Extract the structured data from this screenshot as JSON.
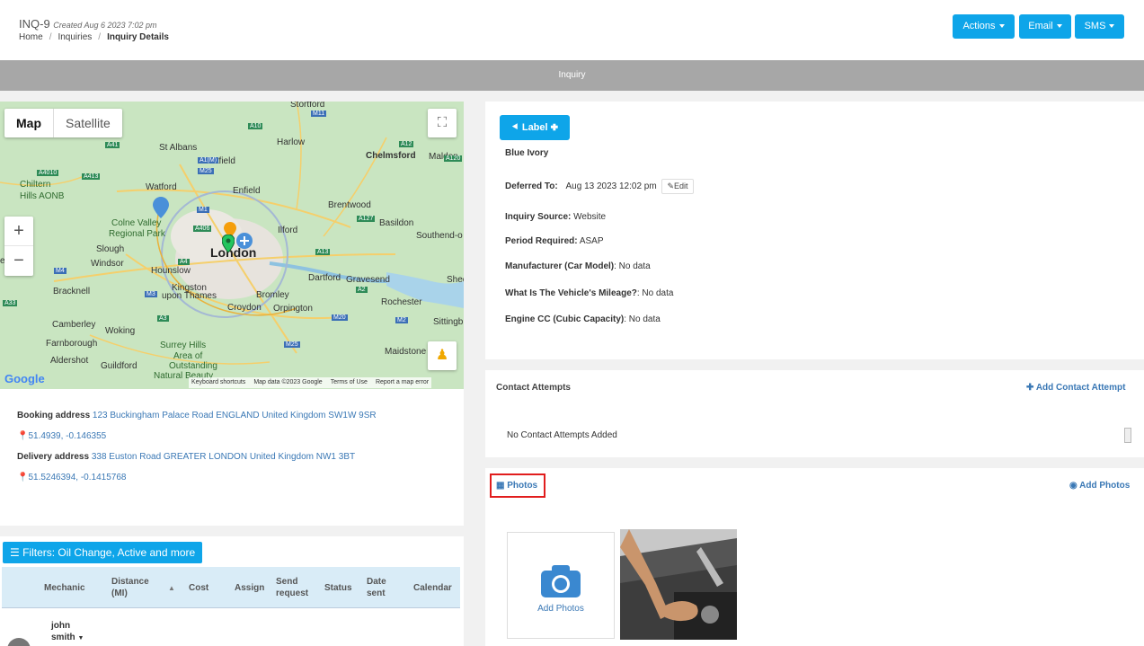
{
  "header": {
    "inquiry_id": "INQ-9",
    "created": "Created Aug 6 2023 7:02 pm",
    "breadcrumb": [
      "Home",
      "Inquiries",
      "Inquiry Details"
    ],
    "buttons": {
      "actions": "Actions",
      "email": "Email",
      "sms": "SMS"
    }
  },
  "section_bar": "Inquiry",
  "map": {
    "type_map": "Map",
    "type_satellite": "Satellite",
    "zoom_in": "+",
    "zoom_out": "−",
    "labels": {
      "stortford": "Stortford",
      "m11": "M11",
      "a10": "A10",
      "harlow": "Harlow",
      "st_albans": "St Albans",
      "hatfield": "Hatfield",
      "chelmsford": "Chelmsford",
      "maldon": "Maldon",
      "a41": "A41",
      "a1m": "A1(M)",
      "m25": "M25",
      "a12": "A12",
      "a120": "A120",
      "a4010": "A4010",
      "a413": "A413",
      "watford": "Watford",
      "enfield": "Enfield",
      "chiltern": "Chiltern",
      "hills_aonb": "Hills AONB",
      "brentwood": "Brentwood",
      "colne_valley": "Colne Valley",
      "regional_park": "Regional Park",
      "m1": "M1",
      "a406": "A406",
      "a127": "A127",
      "basildon": "Basildon",
      "ilford": "Ilford",
      "southend": "Southend-o",
      "slough": "Slough",
      "windsor": "Windsor",
      "hounslow": "Hounslow",
      "london": "London",
      "a13": "A13",
      "m4": "M4",
      "a4": "A4",
      "reading": "eading",
      "bracknell": "Bracknell",
      "m3": "M3",
      "kingston": "Kingston",
      "upon_thames": "upon Thames",
      "bromley": "Bromley",
      "dartford": "Dartford",
      "gravesend": "Gravesend",
      "a2": "A2",
      "a33": "A33",
      "croydon": "Croydon",
      "orpington": "Orpington",
      "rochester": "Rochester",
      "m20": "M20",
      "m2": "M2",
      "camberley": "Camberley",
      "woking": "Woking",
      "a3": "A3",
      "sittingb": "Sittingb",
      "farnborough": "Farnborough",
      "surrey_hills": "Surrey Hills",
      "area_of": "Area of",
      "outstanding": "Outstanding",
      "natural_beauty": "Natural Beauty",
      "aldershot": "Aldershot",
      "guildford": "Guildford",
      "maidstone": "Maidstone",
      "shee": "Shee"
    },
    "footer": [
      "Keyboard shortcuts",
      "Map data ©2023 Google",
      "Terms of Use",
      "Report a map error"
    ],
    "logo": "Google",
    "pin_color_blue": "#4a90d9",
    "pin_color_green": "#22c55e",
    "pin_color_orange": "#f59e0b"
  },
  "addresses": {
    "booking_label": "Booking address",
    "booking_value": "123 Buckingham Palace Road ENGLAND United Kingdom SW1W 9SR",
    "booking_coords": "51.4939, -0.146355",
    "delivery_label": "Delivery address",
    "delivery_value": "338 Euston Road GREATER LONDON United Kingdom NW1 3BT",
    "delivery_coords": "51.5246394, -0.1415768"
  },
  "filters": {
    "button": "Filters: Oil Change, Active and more",
    "columns": [
      "Mechanic",
      "Distance (MI)",
      "Cost",
      "Assign",
      "Send request",
      "Status",
      "Date sent",
      "Calendar"
    ],
    "row_name_first": "john",
    "row_name_last": "smith"
  },
  "details": {
    "label_button": "Label",
    "label_value": "Blue Ivory",
    "deferred_label": "Deferred To:",
    "deferred_value": "Aug 13 2023 12:02 pm",
    "edit": "Edit",
    "source_label": "Inquiry Source:",
    "source_value": "Website",
    "period_label": "Period Required:",
    "period_value": "ASAP",
    "manufacturer_label": "Manufacturer (Car Model)",
    "manufacturer_value": ": No data",
    "mileage_label": "What Is The Vehicle's Mileage?",
    "mileage_value": ": No data",
    "engine_label": "Engine CC (Cubic Capacity)",
    "engine_value": ": No data"
  },
  "contact": {
    "title": "Contact Attempts",
    "add": "Add Contact Attempt",
    "empty": "No Contact Attempts Added"
  },
  "photos": {
    "title": "Photos",
    "add": "Add Photos",
    "add_tile": "Add Photos"
  },
  "colors": {
    "accent": "#0ea5e9",
    "link": "#3a78b5",
    "highlight": "#e11d1d"
  }
}
